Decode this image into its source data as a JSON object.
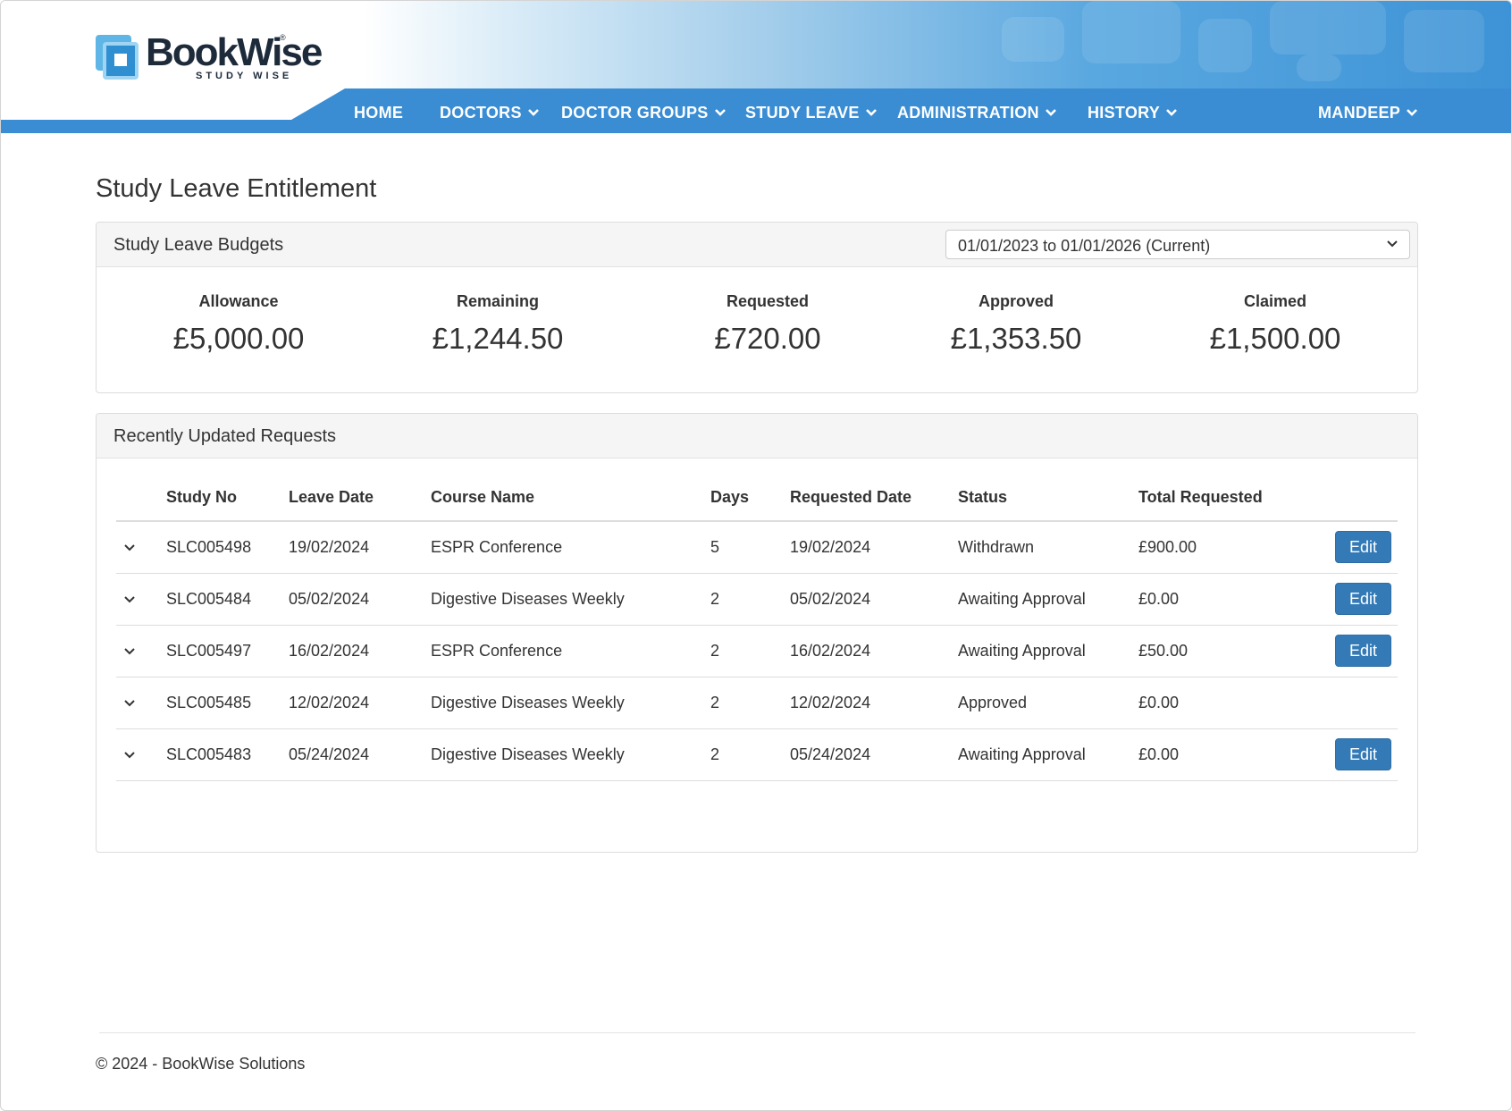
{
  "brand": {
    "name_part1": "Book",
    "name_part2": "Wise",
    "registered": "®",
    "tagline": "STUDY WISE"
  },
  "nav": {
    "items": [
      {
        "label": "HOME",
        "dropdown": false
      },
      {
        "label": "DOCTORS",
        "dropdown": true
      },
      {
        "label": "DOCTOR GROUPS",
        "dropdown": true
      },
      {
        "label": "STUDY LEAVE",
        "dropdown": true
      },
      {
        "label": "ADMINISTRATION",
        "dropdown": true
      },
      {
        "label": "HISTORY",
        "dropdown": true
      }
    ],
    "user": "MANDEEP"
  },
  "page": {
    "title": "Study Leave Entitlement"
  },
  "budgets": {
    "heading": "Study Leave Budgets",
    "period_selected": "01/01/2023 to 01/01/2026 (Current)",
    "stats": [
      {
        "label": "Allowance",
        "value": "£5,000.00"
      },
      {
        "label": "Remaining",
        "value": "£1,244.50"
      },
      {
        "label": "Requested",
        "value": "£720.00"
      },
      {
        "label": "Approved",
        "value": "£1,353.50"
      },
      {
        "label": "Claimed",
        "value": "£1,500.00"
      }
    ]
  },
  "requests": {
    "heading": "Recently Updated Requests",
    "columns": [
      "Study No",
      "Leave Date",
      "Course Name",
      "Days",
      "Requested Date",
      "Status",
      "Total Requested"
    ],
    "edit_label": "Edit",
    "rows": [
      {
        "study_no": "SLC005498",
        "leave_date": "19/02/2024",
        "course": "ESPR Conference",
        "days": "5",
        "requested_date": "19/02/2024",
        "status": "Withdrawn",
        "total": "£900.00",
        "editable": true
      },
      {
        "study_no": "SLC005484",
        "leave_date": "05/02/2024",
        "course": "Digestive Diseases Weekly",
        "days": "2",
        "requested_date": "05/02/2024",
        "status": "Awaiting Approval",
        "total": "£0.00",
        "editable": true
      },
      {
        "study_no": "SLC005497",
        "leave_date": "16/02/2024",
        "course": "ESPR Conference",
        "days": "2",
        "requested_date": "16/02/2024",
        "status": "Awaiting Approval",
        "total": "£50.00",
        "editable": true
      },
      {
        "study_no": "SLC005485",
        "leave_date": "12/02/2024",
        "course": "Digestive Diseases Weekly",
        "days": "2",
        "requested_date": "12/02/2024",
        "status": "Approved",
        "total": "£0.00",
        "editable": false
      },
      {
        "study_no": "SLC005483",
        "leave_date": "05/24/2024",
        "course": "Digestive Diseases Weekly",
        "days": "2",
        "requested_date": "05/24/2024",
        "status": "Awaiting Approval",
        "total": "£0.00",
        "editable": true
      }
    ]
  },
  "footer": {
    "text": "© 2024  - BookWise Solutions"
  },
  "colors": {
    "nav_blue": "#3a8dd3",
    "button_blue": "#337ab7"
  }
}
